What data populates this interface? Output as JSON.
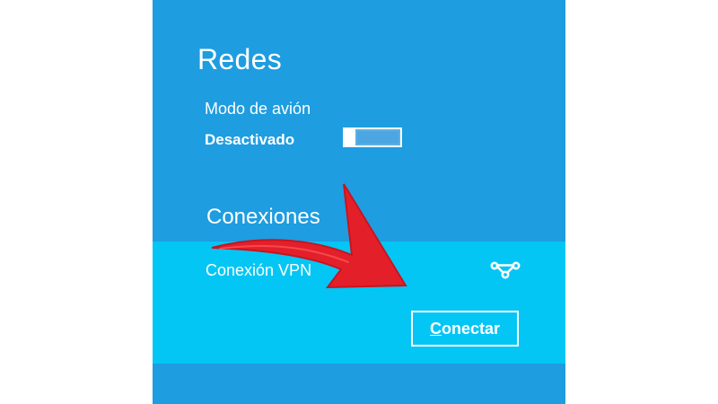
{
  "panel": {
    "title": "Redes",
    "colors": {
      "panel_bg": "#1e9de0",
      "selected_bg": "#03c6f5",
      "text": "#ffffff",
      "annotation_arrow": "#e3202a"
    }
  },
  "airplane_mode": {
    "label": "Modo de avión",
    "state": "Desactivado",
    "on": false
  },
  "connections": {
    "title": "Conexiones",
    "items": [
      {
        "name": "Conexión VPN",
        "icon": "vpn-icon",
        "button": {
          "accelerator": "C",
          "rest": "onectar"
        }
      }
    ]
  }
}
